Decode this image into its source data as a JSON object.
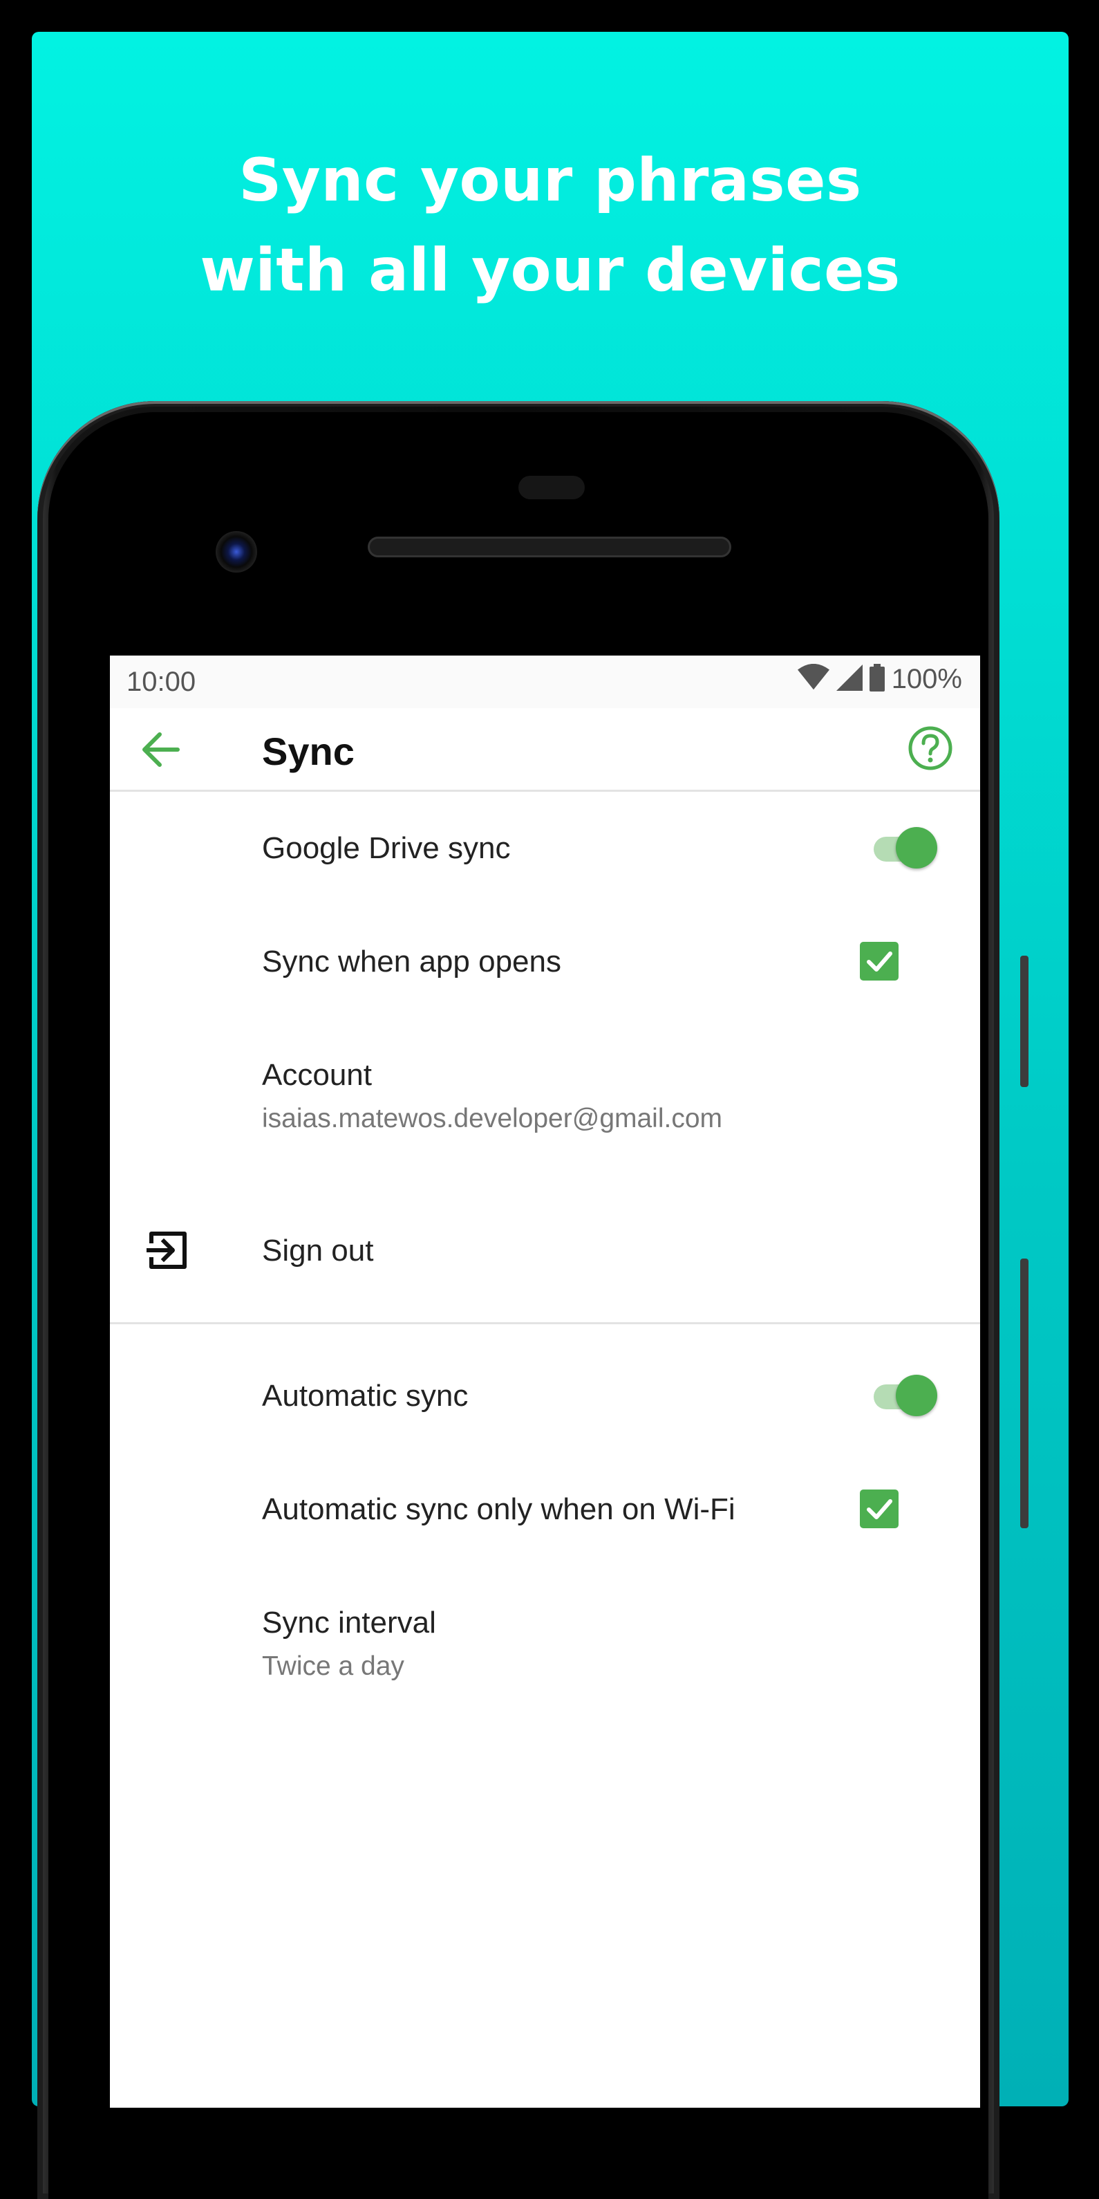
{
  "headline": {
    "line1": "Sync your phrases",
    "line2": "with all your devices"
  },
  "colors": {
    "background_top": "#02f2e2",
    "background_bottom": "#00b0b6",
    "accent_green": "#4caf50"
  },
  "status_bar": {
    "time": "10:00",
    "battery_percent": "100%",
    "icons": [
      "wifi-icon",
      "cell-signal-icon",
      "battery-icon"
    ]
  },
  "toolbar": {
    "title": "Sync",
    "back_icon": "arrow-back-icon",
    "help_icon": "help-circle-icon"
  },
  "settings": {
    "google_drive_sync": {
      "label": "Google Drive sync",
      "enabled": true
    },
    "sync_on_open": {
      "label": "Sync when app opens",
      "checked": true
    },
    "account": {
      "label": "Account",
      "value": "isaias.matewos.developer@gmail.com"
    },
    "sign_out": {
      "label": "Sign out",
      "icon": "exit-to-app-icon"
    },
    "automatic_sync": {
      "label": "Automatic sync",
      "enabled": true
    },
    "wifi_only": {
      "label": "Automatic sync only when on Wi-Fi",
      "checked": true
    },
    "sync_interval": {
      "label": "Sync interval",
      "value": "Twice a day"
    }
  }
}
